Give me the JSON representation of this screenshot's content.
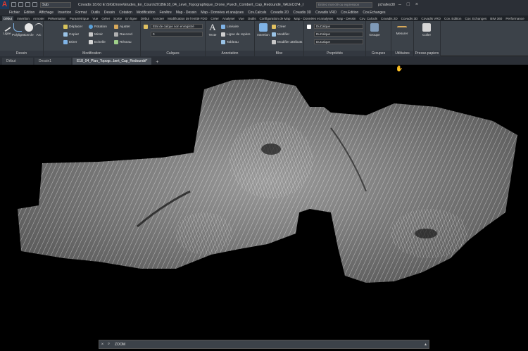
{
  "titlebar": {
    "qa_dropdown": "Sub",
    "title": "Covadis 18.0d   E:\\SIGDrone\\Etudes_En_Cours\\2018\\E18_04_Levé_Topographique_Drone_Puech_Combert_Cap_Redoundé_VALECO\\4_Cartographie...200",
    "search_placeholder": "Entrez mot-clé ou expression",
    "user": "pchalles38"
  },
  "menu": [
    "Fichier",
    "Edition",
    "Affichage",
    "Insertion",
    "Format",
    "Outils",
    "Dessin",
    "Cotation",
    "Modification",
    "Fenêtre",
    "Map - Dessin",
    "Map - Données et analyses",
    "Cov.Calculs",
    "Covadis 2D",
    "Covadis 3D",
    "Covadis VRD",
    "Cov.Edition",
    "Cov.Echanges"
  ],
  "ribbon_tabs": [
    "Début",
    "Insertion",
    "Annoter",
    "Présentation",
    "Paramétrique",
    "Vue",
    "Gérer",
    "Sortie",
    "En ligne",
    "Début",
    "Annoter",
    "Modification de l'entité FDO",
    "Créer",
    "Analyser",
    "Vue",
    "Outils",
    "Configuration de Map",
    "Map - Données et analyses",
    "Map - Dessin",
    "Cov. Calculs",
    "Covadis 2D",
    "Covadis 3D",
    "Covadis VRD",
    "Cov. Edition",
    "Cov. Echanges",
    "BIM 360",
    "Performance"
  ],
  "ribbon": {
    "dessin": {
      "label": "Dessin",
      "ligne": "Ligne",
      "polyligne": "Polyligne",
      "cercle": "Cercle",
      "arc": "Arc"
    },
    "modification": {
      "label": "Modification",
      "deplacer": "Déplacer",
      "rotation": "Rotation",
      "ajuster": "Ajuster",
      "copier": "Copier",
      "miroir": "Miroir",
      "raccord": "Raccord",
      "etirer": "Etirer",
      "echelle": "Echelle",
      "reseau": "Réseau"
    },
    "calques": {
      "label": "Calques",
      "state": "Etat de calque non enregistré",
      "current": "0"
    },
    "annotation": {
      "label": "Annotation",
      "texte": "Texte",
      "lineaire": "Linéaire",
      "ligne_repere": "Ligne de repère",
      "tableau": "Tableau"
    },
    "bloc": {
      "label": "Bloc",
      "insertion": "Insertion",
      "creer": "Créer",
      "modifier": "Modifier",
      "modifier_attributs": "Modifier attributs"
    },
    "proprietes": {
      "label": "Propriétés",
      "par_calque_1": "DuCalque",
      "par_calque_2": "DuCalque",
      "par_calque_3": "DuCalque"
    },
    "groupes": {
      "label": "Groupes",
      "groupe": "Groupe"
    },
    "utilitaires": {
      "label": "Utilitaires",
      "mesurer": "Mesurer"
    },
    "presse_papiers": {
      "label": "Presse-papiers",
      "coller": "Coller"
    }
  },
  "doc_tabs": [
    "Début",
    "Dessin1",
    "E18_04_Plan_Topogr...bert_Cap_Redoundé*"
  ],
  "command_line": {
    "text": "ZOOM"
  },
  "colors": {
    "accent": "#3d8fd6",
    "background": "#000000",
    "ribbon": "#3c4249"
  }
}
